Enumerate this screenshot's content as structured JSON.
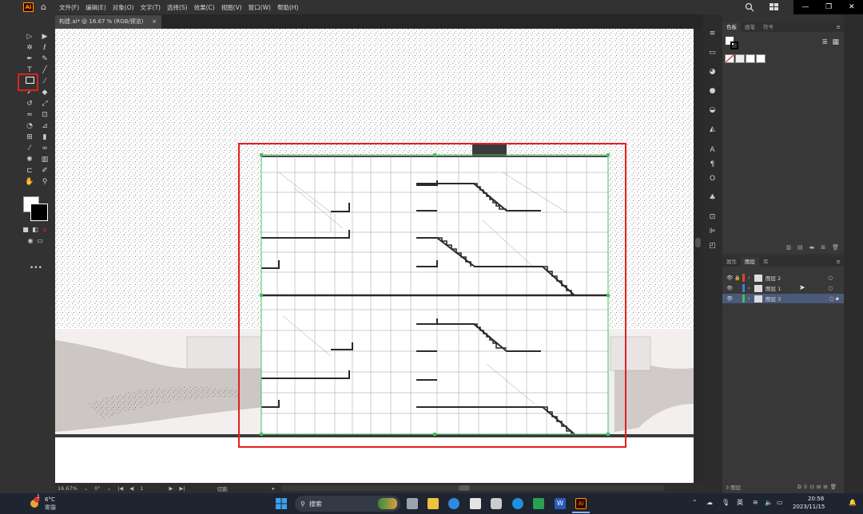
{
  "app": {
    "logo": "Ai",
    "menu": [
      "文件(F)",
      "编辑(E)",
      "对象(O)",
      "文字(T)",
      "选择(S)",
      "效果(C)",
      "视图(V)",
      "窗口(W)",
      "帮助(H)"
    ]
  },
  "document": {
    "tab_title": "构建.ai* @ 16.67 % (RGB/预览)",
    "close": "×"
  },
  "status": {
    "zoom": "16.67%",
    "angle": "0°",
    "artboard": "1",
    "tool": "切割"
  },
  "panels": {
    "top_tabs": [
      "色板",
      "画笔",
      "符号"
    ],
    "bottom_tabs": [
      "属性",
      "图层",
      "库"
    ],
    "layers": [
      {
        "name": "图层 2",
        "color": "#e0403a",
        "locked": true
      },
      {
        "name": "图层 1",
        "color": "#4a7ad8",
        "locked": false
      },
      {
        "name": "图层 3",
        "color": "#3ec060",
        "locked": false,
        "selected": true
      }
    ],
    "layers_count": "3 图层"
  },
  "taskbar": {
    "weather_temp": "6°C",
    "weather_text": "雾霾",
    "weather_badge": "1",
    "search_label": "搜索",
    "ime": "英",
    "time": "20:58",
    "date": "2023/11/15"
  },
  "icons": {
    "home": "home-icon",
    "search": "search-icon",
    "windows": "windows-start-icon"
  },
  "colors": {
    "highlight_red": "#e02020",
    "artboard_green": "#41c060",
    "accent_selected": "#4a5a78"
  }
}
